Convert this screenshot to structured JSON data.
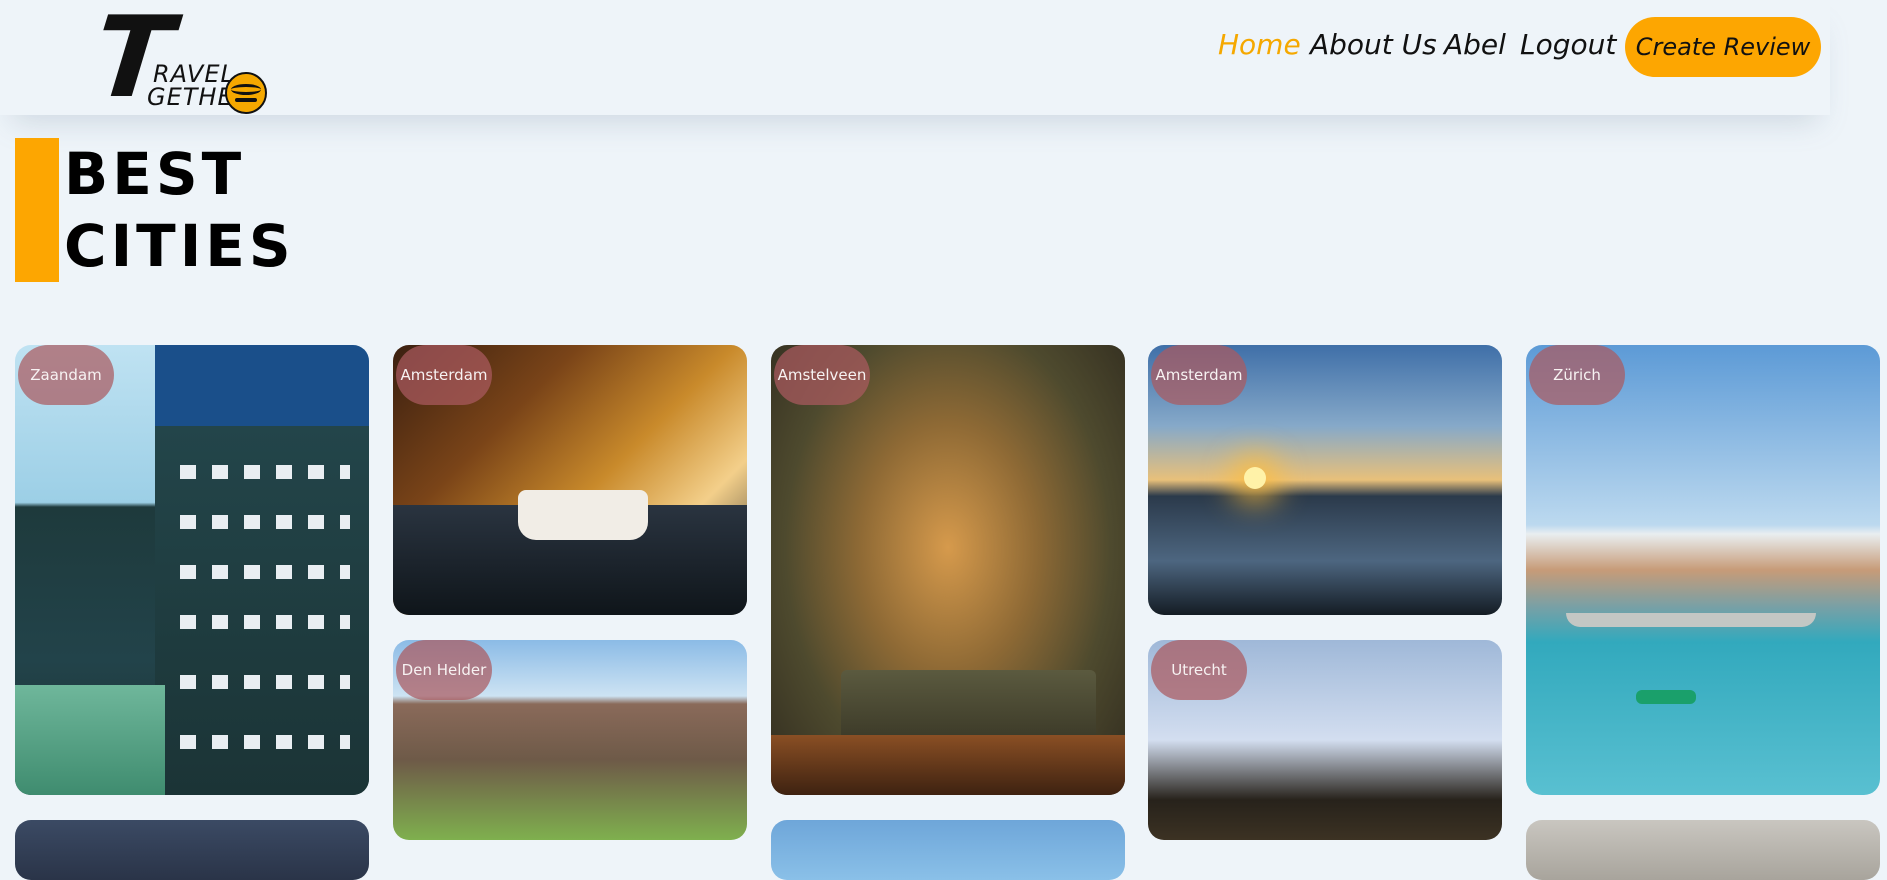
{
  "header": {
    "logo": {
      "initial": "T",
      "line1": "RAVEL",
      "line2": "GETHE"
    },
    "nav": [
      {
        "label": "Home",
        "active": true
      },
      {
        "label": "About Us",
        "active": false
      },
      {
        "label": "Abel",
        "active": false
      },
      {
        "label": "Logout",
        "active": false
      }
    ],
    "create_button": "Create Review"
  },
  "section": {
    "title_line1": "BEST",
    "title_line2": "CITIES"
  },
  "cities": [
    {
      "name": "Zaandam"
    },
    {
      "name": "Amsterdam"
    },
    {
      "name": "Amstelveen"
    },
    {
      "name": "Amsterdam"
    },
    {
      "name": "Zürich"
    },
    {
      "name": "Den Helder"
    },
    {
      "name": "Utrecht"
    }
  ],
  "colors": {
    "accent": "#fda601",
    "background": "#eef4f9",
    "tag": "#aa5a5f"
  }
}
